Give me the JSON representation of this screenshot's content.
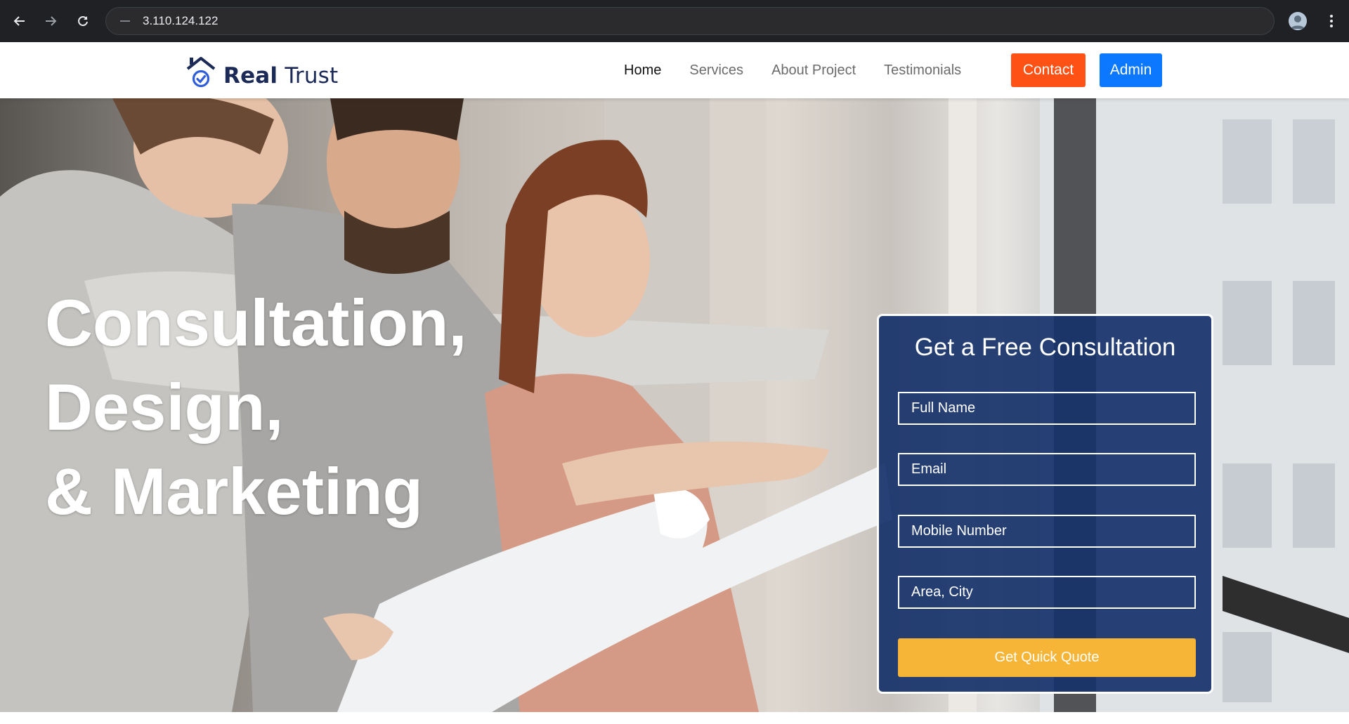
{
  "browser": {
    "url": "3.110.124.122"
  },
  "header": {
    "logo_bold": "Real",
    "logo_light": "Trust",
    "nav": [
      {
        "label": "Home",
        "active": true
      },
      {
        "label": "Services",
        "active": false
      },
      {
        "label": "About Project",
        "active": false
      },
      {
        "label": "Testimonials",
        "active": false
      }
    ],
    "contact_label": "Contact",
    "admin_label": "Admin"
  },
  "hero": {
    "lines": [
      "Consultation,",
      "Design,",
      "& Marketing"
    ]
  },
  "form": {
    "title": "Get a Free Consultation",
    "full_name_placeholder": "Full Name",
    "email_placeholder": "Email",
    "mobile_placeholder": "Mobile Number",
    "city_placeholder": "Area, City",
    "submit_label": "Get Quick Quote"
  },
  "colors": {
    "brand_navy": "#1b2a57",
    "contact_orange": "#fe5115",
    "admin_blue": "#0b78ff",
    "form_bg": "#18336b",
    "quote_yellow": "#f6b536"
  }
}
